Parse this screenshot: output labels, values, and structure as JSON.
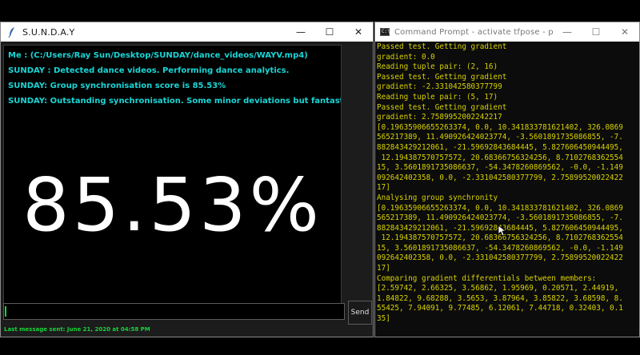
{
  "left_window": {
    "title": "S.U.N.D.A.Y",
    "controls": {
      "minimize": "—",
      "maximize": "☐",
      "close": "✕"
    },
    "messages": [
      "Me : (C:/Users/Ray Sun/Desktop/SUNDAY/dance_videos/WAYV.mp4)",
      "SUNDAY : Detected dance videos. Performing dance analytics.",
      "SUNDAY: Group synchronisation score is 85.53%",
      "SUNDAY: Outstanding synchronisation. Some minor deviations but fantastic overall"
    ],
    "score_display": "85.53%",
    "input_value": "",
    "send_label": "Send",
    "status": "Last message sent: June 21, 2020 at 04:58 PM",
    "colors": {
      "chat_text": "#19d6d6",
      "status_text": "#18d33a",
      "score_text": "#ffffff"
    }
  },
  "right_window": {
    "title": "Command Prompt - activate  tfpose - python ...",
    "icon_text": "C:\\",
    "controls": {
      "minimize": "—",
      "maximize": "☐",
      "close": "✕"
    },
    "console_lines": [
      "Passed test. Getting gradient",
      "gradient: 0.0",
      "Reading tuple pair: (2, 16)",
      "Passed test. Getting gradient",
      "gradient: -2.331042580377799",
      "Reading tuple pair: (5, 17)",
      "Passed test. Getting gradient",
      "gradient: 2.7589952002242217",
      "[0.19635906655263374, 0.0, 10.341833781621402, 326.0869",
      "565217389, 11.490926424023774, -3.5601891735086855, -7.",
      "882843429212061, -21.59692843684445, 5.827606450944495,",
      " 12.194387570757572, 20.68366756324256, 8.7102768362554",
      "15, 3.5601891735086637, -54.3478260869562, -0.0, -1.149",
      "092642402358, 0.0, -2.331042580377799, 2.75899520022422",
      "17]",
      "Analysing group synchronity",
      "[0.19635906655263374, 0.0, 10.341833781621402, 326.0869",
      "565217389, 11.490926424023774, -3.5601891735086855, -7.",
      "882843429212061, -21.59692843684445, 5.827606450944495,",
      " 12.194387570757572, 20.68366756324256, 8.7102768362554",
      "15, 3.5601891735086637, -54.3478260869562, -0.0, -1.149",
      "092642402358, 0.0, -2.331042580377799, 2.75899520022422",
      "17]",
      "Comparing gradient differentials between members:",
      "[2.59742, 2.66325, 3.56862, 1.95969, 0.20571, 2.44919,",
      "1.84822, 9.68288, 3.5653, 3.87964, 3.85822, 3.68598, 8.",
      "55425, 7.94091, 9.77485, 6.12061, 7.44718, 0.32403, 0.1",
      "35]"
    ],
    "colors": {
      "console_text": "#d8d200"
    }
  }
}
